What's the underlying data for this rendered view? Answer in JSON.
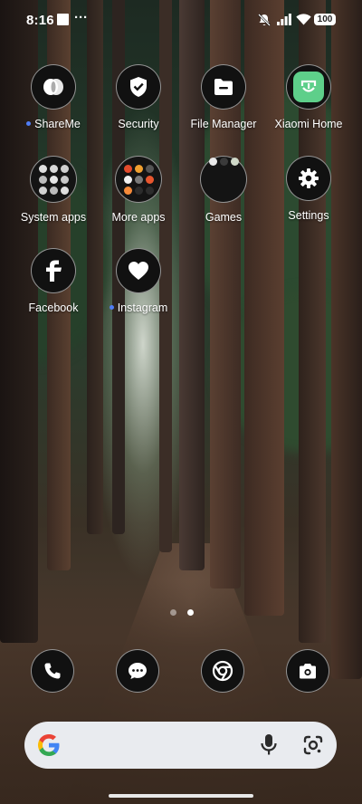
{
  "status_bar": {
    "time": "8:16",
    "more": "···",
    "battery": "100"
  },
  "apps": [
    {
      "label": "ShareMe",
      "icon": "shareme-icon",
      "new_dot": true
    },
    {
      "label": "Security",
      "icon": "shield-check-icon",
      "new_dot": false
    },
    {
      "label": "File Manager",
      "icon": "folder-icon",
      "new_dot": false
    },
    {
      "label": "Xiaomi Home",
      "icon": "mi-home-icon",
      "new_dot": false
    },
    {
      "label": "System apps",
      "icon": "folder-system-apps",
      "new_dot": false
    },
    {
      "label": "More apps",
      "icon": "folder-more-apps",
      "new_dot": false
    },
    {
      "label": "Games",
      "icon": "folder-games",
      "new_dot": false
    },
    {
      "label": "Settings",
      "icon": "gear-icon",
      "new_dot": false
    },
    {
      "label": "Facebook",
      "icon": "facebook-icon",
      "new_dot": false
    },
    {
      "label": "Instagram",
      "icon": "heart-icon",
      "new_dot": true
    }
  ],
  "pager": {
    "pages": 2,
    "current": 2
  },
  "dock": [
    {
      "name": "phone",
      "icon": "phone-icon"
    },
    {
      "name": "messages",
      "icon": "message-icon"
    },
    {
      "name": "chrome",
      "icon": "chrome-icon"
    },
    {
      "name": "camera",
      "icon": "camera-icon"
    }
  ],
  "colors": {
    "new_dot": "#4f7df5",
    "icon_bg": "#111111",
    "search_bg": "#e9ebef",
    "mi_home_green": "#5ecf8a"
  }
}
